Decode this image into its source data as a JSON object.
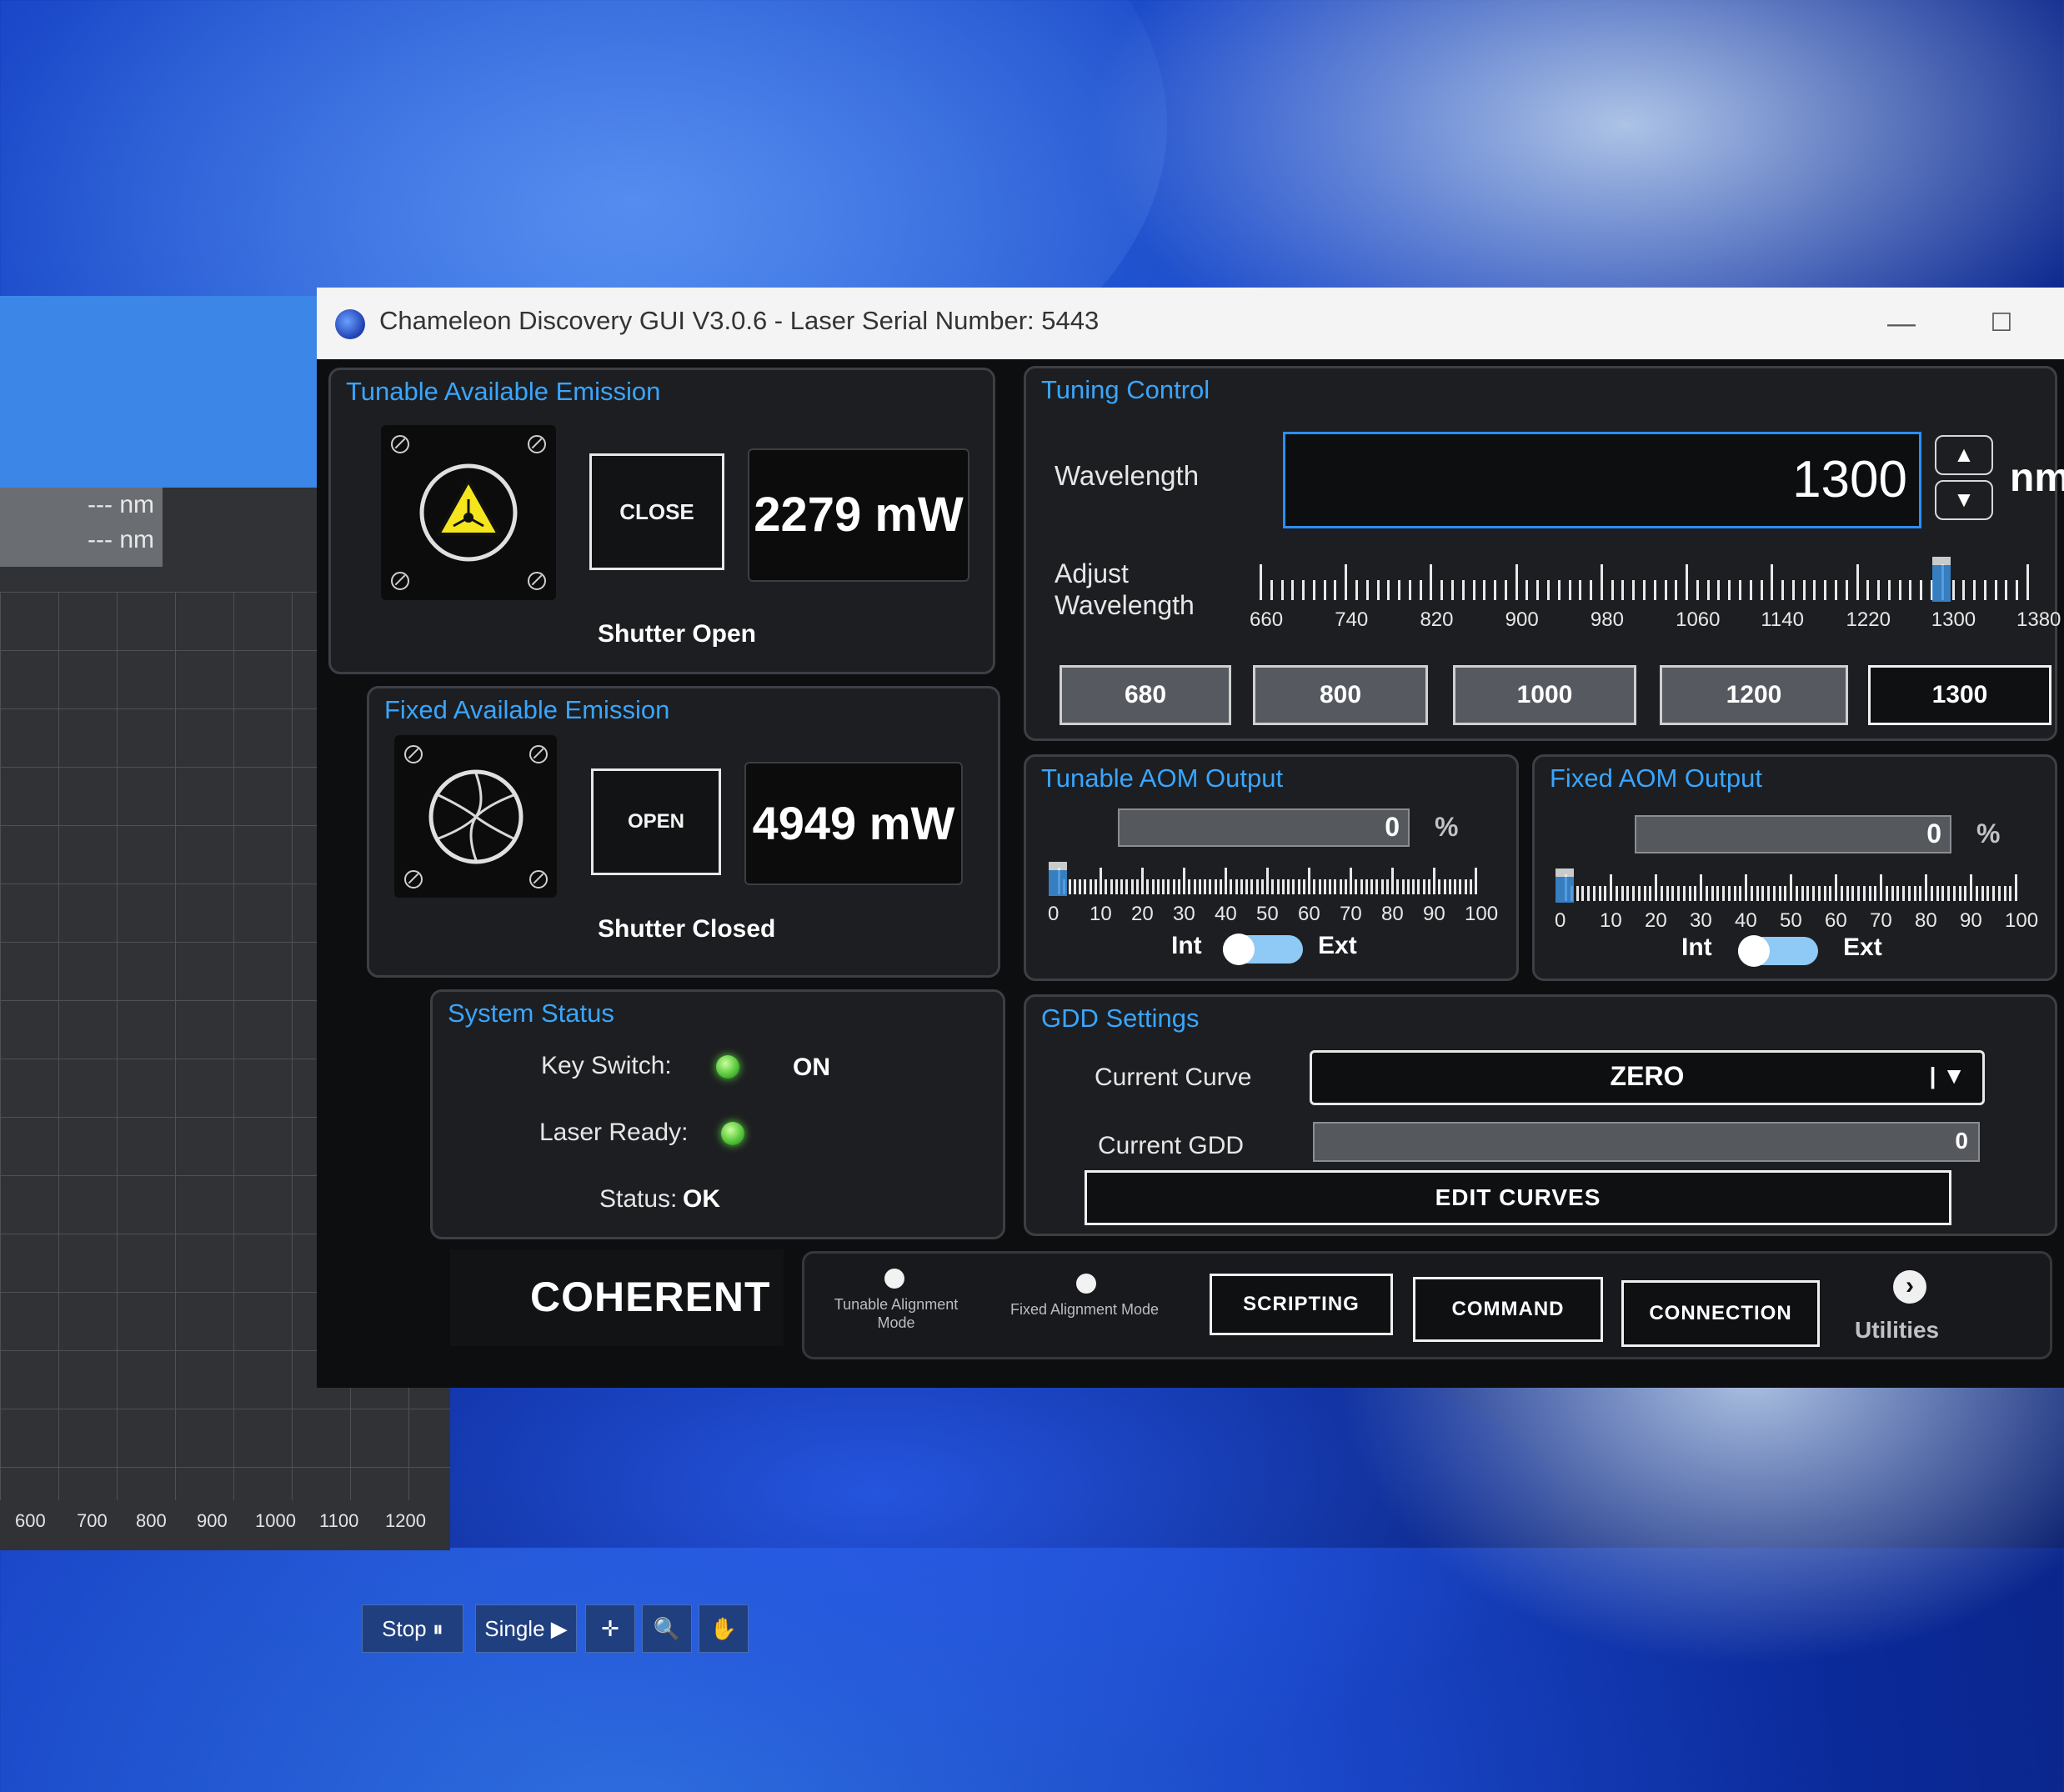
{
  "background_app": {
    "nm_lines": [
      "--- nm",
      "--- nm"
    ],
    "axis_ticks": [
      "600",
      "700",
      "800",
      "900",
      "1000",
      "1100",
      "1200"
    ],
    "controls": {
      "stop": "Stop ⏸",
      "single": "Single ▶",
      "crosshair_icon": "✛",
      "zoom_icon": "🔍",
      "hand_icon": "✋"
    }
  },
  "window": {
    "title": "Chameleon Discovery GUI V3.0.6 - Laser Serial Number: 5443",
    "minimize": "—",
    "maximize": "☐"
  },
  "tunable_emission": {
    "title": "Tunable Available Emission",
    "button": "CLOSE",
    "power": "2279 mW",
    "status": "Shutter Open"
  },
  "fixed_emission": {
    "title": "Fixed Available Emission",
    "button": "OPEN",
    "power": "4949 mW",
    "status": "Shutter Closed"
  },
  "system_status": {
    "title": "System Status",
    "key_switch_label": "Key Switch:",
    "key_switch_value": "ON",
    "laser_ready_label": "Laser Ready:",
    "status_text": "Status:",
    "status_value": "OK",
    "led_color": "#4fc235"
  },
  "brand": {
    "logo_text": "COHERENT"
  },
  "tuning_control": {
    "title": "Tuning Control",
    "wavelength_label": "Wavelength",
    "wavelength_value": "1300",
    "unit": "nm",
    "spin_up": "▲",
    "spin_down": "▼",
    "adjust_label_1": "Adjust",
    "adjust_label_2": "Wavelength",
    "ruler_labels": [
      "660",
      "740",
      "820",
      "900",
      "980",
      "1060",
      "1140",
      "1220",
      "1300",
      "1380"
    ],
    "ruler_min": 660,
    "ruler_max": 1380,
    "slider_value": 1300,
    "presets": [
      "680",
      "800",
      "1000",
      "1200",
      "1300"
    ],
    "selected_preset": "1300"
  },
  "tunable_aom": {
    "title": "Tunable AOM Output",
    "value": "0",
    "unit": "%",
    "ruler_labels": [
      "0",
      "10",
      "20",
      "30",
      "40",
      "50",
      "60",
      "70",
      "80",
      "90",
      "100"
    ],
    "slider_value": 0,
    "int_label": "Int",
    "ext_label": "Ext"
  },
  "fixed_aom": {
    "title": "Fixed AOM Output",
    "value": "0",
    "unit": "%",
    "ruler_labels": [
      "0",
      "10",
      "20",
      "30",
      "40",
      "50",
      "60",
      "70",
      "80",
      "90",
      "100"
    ],
    "slider_value": 0,
    "int_label": "Int",
    "ext_label": "Ext"
  },
  "gdd_settings": {
    "title": "GDD Settings",
    "curve_label": "Current Curve",
    "curve_value": "ZERO",
    "gdd_label": "Current GDD",
    "gdd_value": "0",
    "edit_button": "EDIT CURVES"
  },
  "bottom_bar": {
    "tunable_alignment": "Tunable Alignment Mode",
    "fixed_alignment": "Fixed Alignment Mode",
    "scripting": "SCRIPTING",
    "command": "COMMAND",
    "connection": "CONNECTION",
    "utilities": "Utilities",
    "utilities_icon": "›"
  },
  "colors": {
    "accent": "#39a6ff",
    "panel": "#1d1e21",
    "background": "#0d0e10"
  }
}
